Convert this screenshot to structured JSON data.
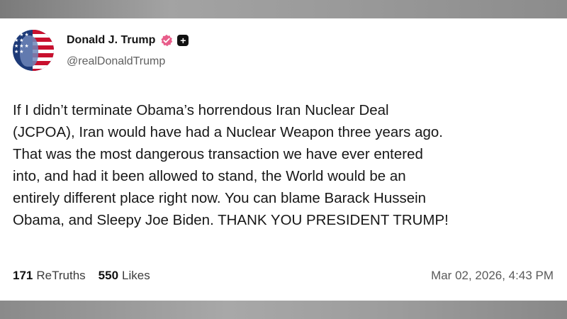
{
  "post": {
    "author": {
      "display_name": "Donald J. Trump",
      "handle": "@realDonaldTrump",
      "verified_icon": "verified-badge-icon",
      "badge_icon": "plus-badge-icon",
      "verified_color": "#e85d8a"
    },
    "text": "If I didn’t terminate Obama’s horrendous Iran Nuclear Deal\n(JCPOA), Iran would have had a Nuclear Weapon three years ago.\nThat was the most dangerous transaction we have ever entered\ninto, and had it been allowed to stand, the World would be an\nentirely different place right now. You can blame Barack Hussein\nObama, and Sleepy Joe Biden. THANK YOU PRESIDENT TRUMP!",
    "stats": {
      "retruths_count": "171",
      "retruths_label": "ReTruths",
      "likes_count": "550",
      "likes_label": "Likes"
    },
    "timestamp": "Mar 02, 2026, 4:43 PM"
  }
}
